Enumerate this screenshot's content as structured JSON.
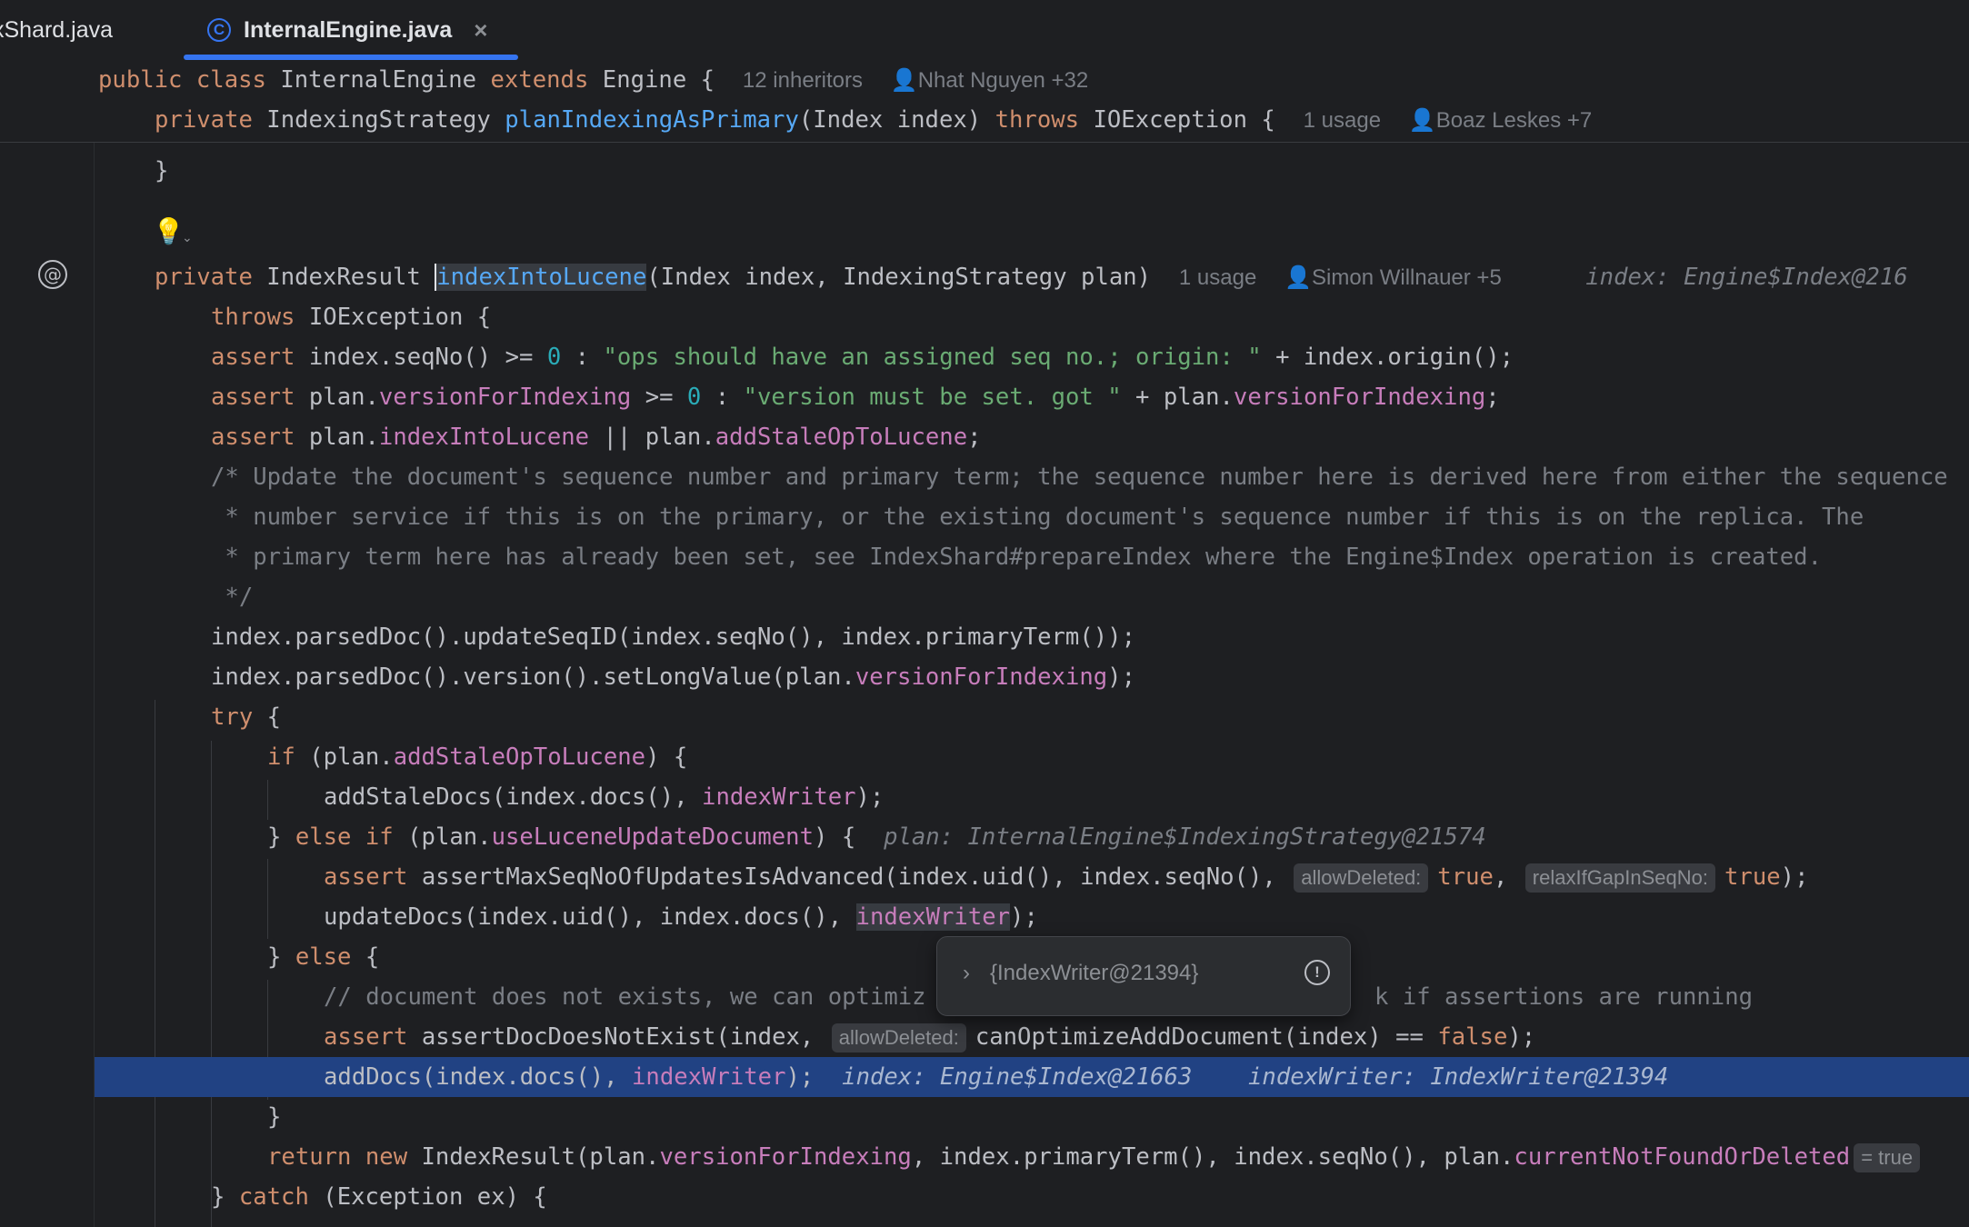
{
  "tabs": [
    {
      "label": "xShard.java"
    },
    {
      "label": "InternalEngine.java",
      "icon": "class-icon",
      "close": "×"
    }
  ],
  "sticky": {
    "line1": {
      "kw1": "public",
      "kw2": "class",
      "name": "InternalEngine",
      "kw3": "extends",
      "parent": "Engine",
      "brace": "{",
      "inheritors": "12 inheritors",
      "authors": "Nhat Nguyen +32"
    },
    "line2": {
      "kw1": "private",
      "type": "IndexingStrategy",
      "fn": "planIndexingAsPrimary",
      "params": "(Index index)",
      "kw2": "throws",
      "exc": "IOException",
      "brace": "{",
      "usage": "1 usage",
      "authors": "Boaz Leskes +7"
    }
  },
  "code": {
    "close_brace": "}",
    "decl": {
      "kw": "private",
      "type": "IndexResult",
      "fn": "indexIntoLucene",
      "params": "(Index index, IndexingStrategy plan)",
      "usage": "1 usage",
      "authors": "Simon Willnauer +5",
      "debug": "index: Engine$Index@216"
    },
    "throws": {
      "kw": "throws",
      "rest": "IOException {"
    },
    "assert1": {
      "kw": "assert",
      "a": "index.seqNo() >= ",
      "num": "0",
      "b": " : ",
      "str": "\"ops should have an assigned seq no.; origin: \"",
      "c": " + index.origin();"
    },
    "assert2": {
      "kw": "assert",
      "a": "plan.",
      "fld": "versionForIndexing",
      "b": " >= ",
      "num": "0",
      "c": " : ",
      "str": "\"version must be set. got \"",
      "d": " + plan.",
      "fld2": "versionForIndexing",
      "e": ";"
    },
    "assert3": {
      "kw": "assert",
      "a": "plan.",
      "fld": "indexIntoLucene",
      "b": " || plan.",
      "fld2": "addStaleOpToLucene",
      "c": ";"
    },
    "comment1": "/* Update the document's sequence number and primary term; the sequence number here is derived here from either the sequence",
    "comment2": " * number service if this is on the primary, or the existing document's sequence number if this is on the replica. The",
    "comment3": " * primary term here has already been set, see IndexShard#prepareIndex where the Engine$Index operation is created.",
    "comment4": " */",
    "stmt1": "index.parsedDoc().updateSeqID(index.seqNo(), index.primaryTerm());",
    "stmt2": {
      "a": "index.parsedDoc().version().setLongValue(plan.",
      "fld": "versionForIndexing",
      "b": ");"
    },
    "try": {
      "kw": "try",
      "rest": " {"
    },
    "if1": {
      "kw": "if",
      "a": " (plan.",
      "fld": "addStaleOpToLucene",
      "b": ") {"
    },
    "stale": {
      "a": "addStaleDocs(index.docs(), ",
      "fld": "indexWriter",
      "b": ");"
    },
    "elseif": {
      "a": "} ",
      "kw1": "else",
      "kw2": "if",
      "b": " (plan.",
      "fld": "useLuceneUpdateDocument",
      "c": ") {",
      "debug": "plan: InternalEngine$IndexingStrategy@21574"
    },
    "assert4": {
      "kw": "assert",
      "a": "assertMaxSeqNoOfUpdatesIsAdvanced(index.uid(), index.seqNo(), ",
      "hint1": "allowDeleted:",
      "v1": "true",
      "comma": ",",
      "hint2": "relaxIfGapInSeqNo:",
      "v2": "true",
      "end": ");"
    },
    "update": {
      "a": "updateDocs(index.uid(), index.docs(), ",
      "fld": "indexWriter",
      "b": ");"
    },
    "else": {
      "a": "} ",
      "kw": "else",
      "b": " {"
    },
    "comment5": "// document does not exists, we can optimiz",
    "comment5b": "k if assertions are running",
    "assert5": {
      "kw": "assert",
      "a": "assertDocDoesNotExist(index, ",
      "hint": "allowDeleted:",
      "b": "canOptimizeAddDocument(index) == ",
      "v": "false",
      "c": ");"
    },
    "add": {
      "a": "addDocs(index.docs(), ",
      "fld": "indexWriter",
      "b": ");",
      "debug1": "index: Engine$Index@21663",
      "debug2": "indexWriter: IndexWriter@21394"
    },
    "close2": "}",
    "return": {
      "kw1": "return",
      "kw2": "new",
      "a": " IndexResult(plan.",
      "fld": "versionForIndexing",
      "b": ", index.primaryTerm(), index.seqNo(), plan.",
      "fld2": "currentNotFoundOrDeleted",
      "inlay": "= true"
    },
    "catch": {
      "a": "} ",
      "kw": "catch",
      "b": " (Exception ex) {"
    }
  },
  "popup": {
    "value": "{IndexWriter@21394}",
    "expand": "›",
    "info": "!"
  }
}
